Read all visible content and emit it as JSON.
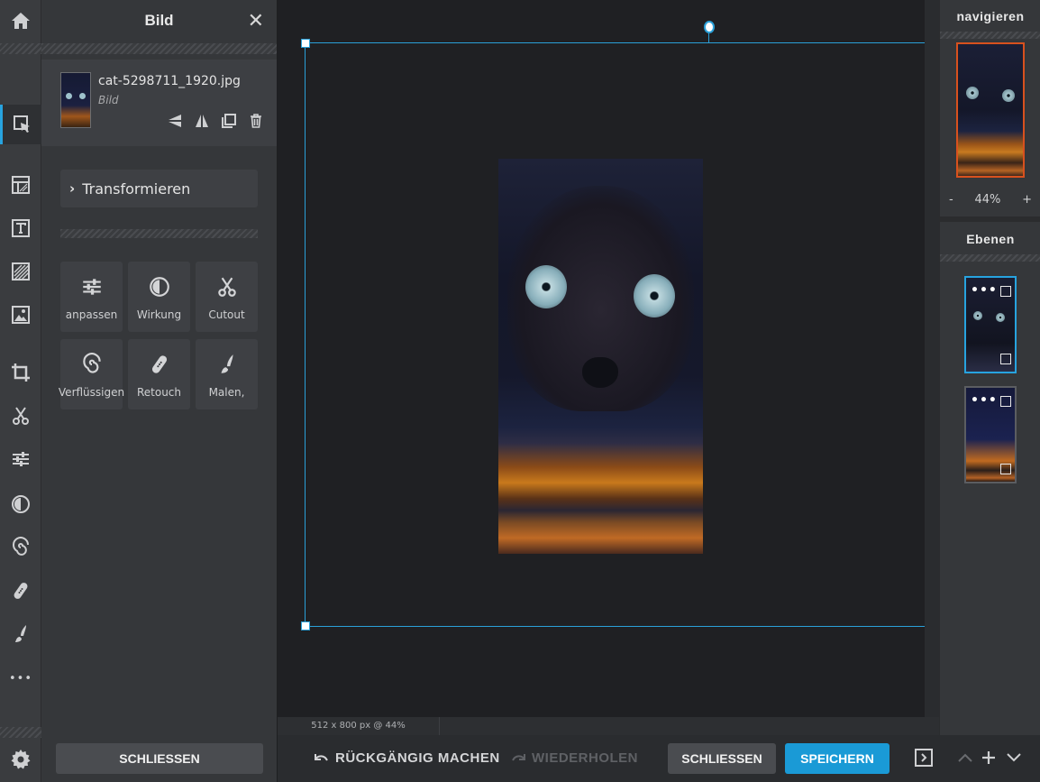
{
  "left_panel": {
    "title": "Bild",
    "close_glyph": "✕",
    "file": {
      "name": "cat-5298711_1920.jpg",
      "type": "Bild"
    },
    "transform_label": "Transformieren",
    "tools": [
      {
        "label": "anpassen",
        "icon": "sliders-icon"
      },
      {
        "label": "Wirkung",
        "icon": "contrast-icon"
      },
      {
        "label": "Cutout",
        "icon": "scissors-icon"
      },
      {
        "label": "Verflüssigen",
        "icon": "spiral-icon"
      },
      {
        "label": "Retouch",
        "icon": "bandage-icon"
      },
      {
        "label": "Malen,",
        "icon": "brush-icon"
      }
    ],
    "close_button": "SCHLIESSEN"
  },
  "rail": {
    "more_glyph": "•••",
    "icons": [
      "home-icon",
      "select-icon",
      "layout-icon",
      "text-icon",
      "texture-icon",
      "image-icon",
      "crop-icon",
      "cutout-icon",
      "adjust-icon",
      "effect-icon",
      "liquify-icon",
      "retouch-icon",
      "paint-icon",
      "more-icon",
      "settings-icon"
    ]
  },
  "canvas": {
    "status": "512 x 800 px @ 44%"
  },
  "right_panel": {
    "navigate_title": "navigieren",
    "zoom": {
      "minus": "-",
      "value": "44%",
      "plus": "+"
    },
    "layers_title": "Ebenen",
    "layer_dots": "•••"
  },
  "bottom_bar": {
    "undo": "RÜCKGÄNGIG MACHEN",
    "redo": "WIEDERHOLEN",
    "close": "SCHLIESSEN",
    "save": "SPEICHERN"
  },
  "colors": {
    "accent": "#27a3df",
    "save": "#1a9ad6",
    "nav_border": "#d8511e"
  }
}
